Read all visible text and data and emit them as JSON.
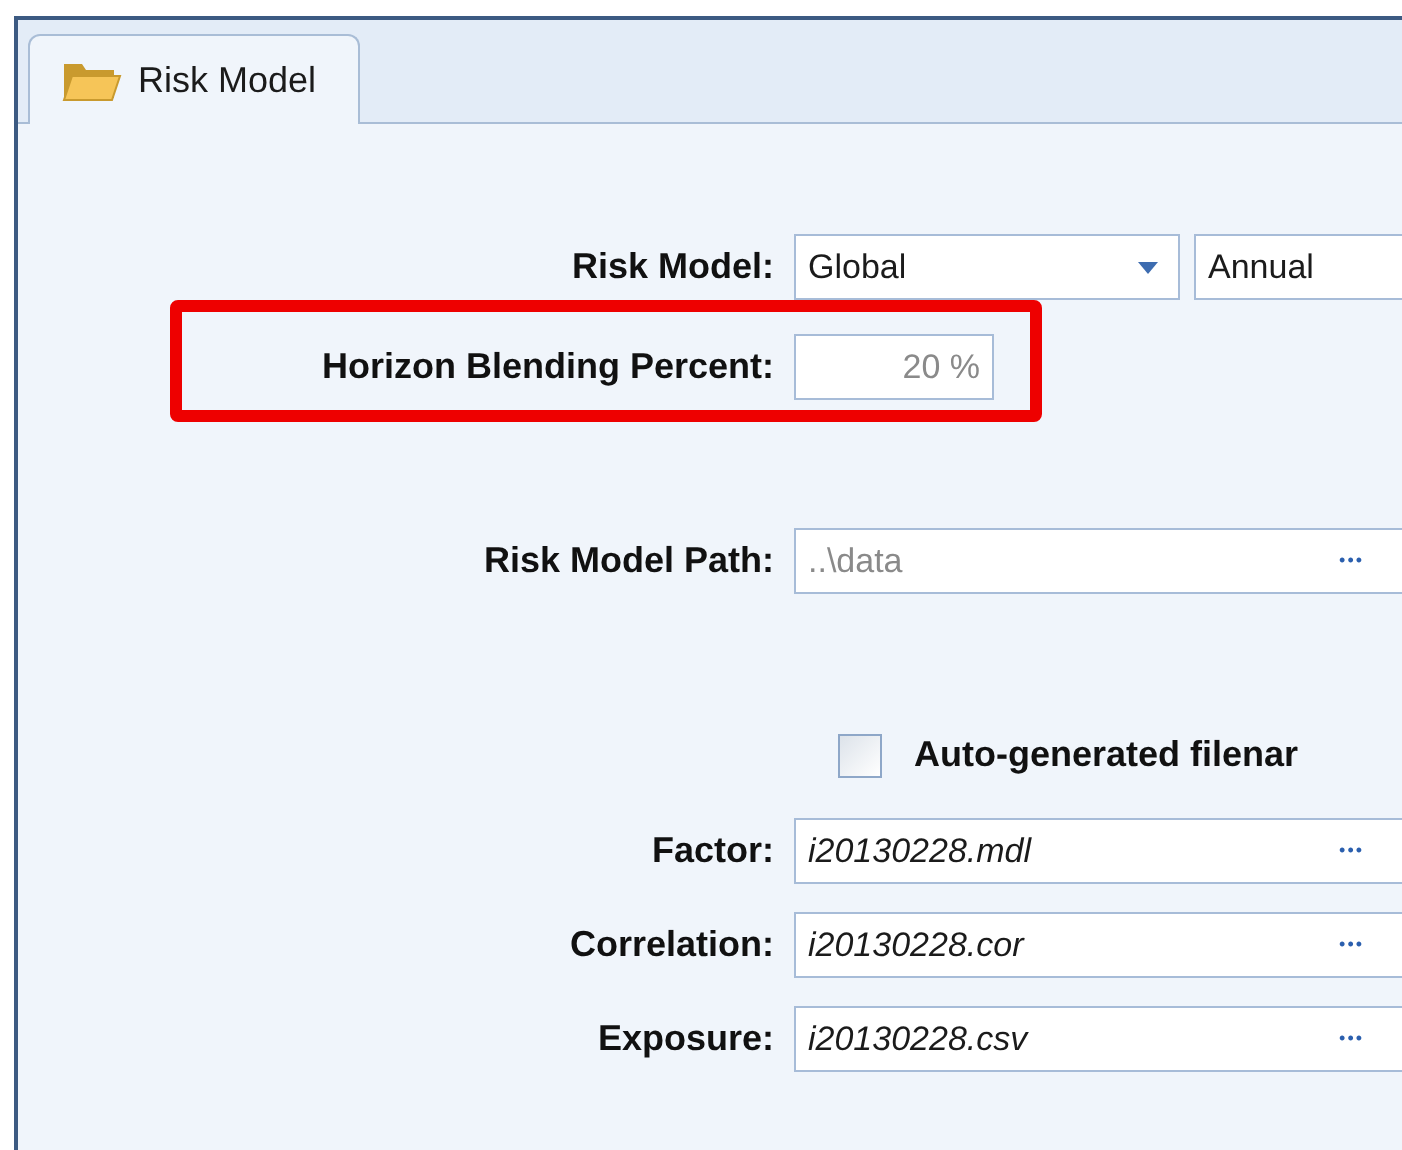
{
  "tab": {
    "label": "Risk Model",
    "selected": true
  },
  "risk_model": {
    "label": "Risk Model:",
    "model": {
      "value": "Global"
    },
    "horizon": {
      "value": "Annual"
    }
  },
  "horizon_blending": {
    "label": "Horizon Blending Percent:",
    "value": "20 %",
    "disabled": true,
    "highlighted": true
  },
  "path": {
    "label": "Risk Model Path:",
    "value": "..\\data",
    "disabled": true,
    "button": "•••"
  },
  "auto_filenames": {
    "label": "Auto-generated filenar",
    "checked": false
  },
  "files": [
    {
      "label": "Factor:",
      "value": "i20130228.mdl",
      "button": "•••"
    },
    {
      "label": "Correlation:",
      "value": "i20130228.cor",
      "button": "•••"
    },
    {
      "label": "Exposure:",
      "value": "i20130228.csv",
      "button": "•••"
    }
  ]
}
